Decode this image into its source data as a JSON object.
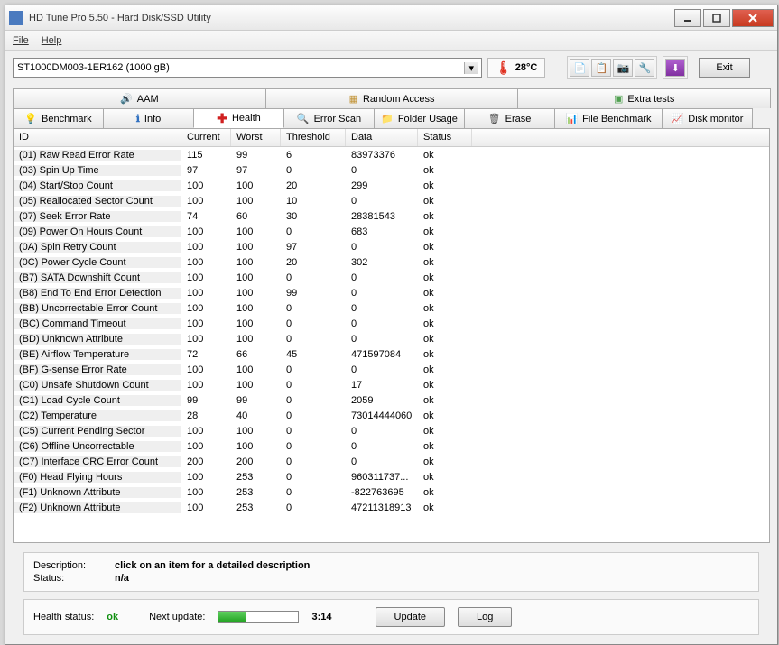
{
  "window": {
    "title": "HD Tune Pro 5.50 - Hard Disk/SSD Utility"
  },
  "menu": {
    "file": "File",
    "help": "Help"
  },
  "toolbar": {
    "drive": "ST1000DM003-1ER162 (1000 gB)",
    "temp": "28°C",
    "exit": "Exit"
  },
  "tabs_top": {
    "aam": "AAM",
    "random": "Random Access",
    "extra": "Extra tests"
  },
  "tabs_bottom": {
    "benchmark": "Benchmark",
    "info": "Info",
    "health": "Health",
    "errorscan": "Error Scan",
    "folder": "Folder Usage",
    "erase": "Erase",
    "filebench": "File Benchmark",
    "diskmon": "Disk monitor"
  },
  "columns": {
    "id": "ID",
    "current": "Current",
    "worst": "Worst",
    "threshold": "Threshold",
    "data": "Data",
    "status": "Status"
  },
  "rows": [
    {
      "id": "(01) Raw Read Error Rate",
      "cur": "115",
      "worst": "99",
      "thr": "6",
      "data": "83973376",
      "st": "ok"
    },
    {
      "id": "(03) Spin Up Time",
      "cur": "97",
      "worst": "97",
      "thr": "0",
      "data": "0",
      "st": "ok"
    },
    {
      "id": "(04) Start/Stop Count",
      "cur": "100",
      "worst": "100",
      "thr": "20",
      "data": "299",
      "st": "ok"
    },
    {
      "id": "(05) Reallocated Sector Count",
      "cur": "100",
      "worst": "100",
      "thr": "10",
      "data": "0",
      "st": "ok"
    },
    {
      "id": "(07) Seek Error Rate",
      "cur": "74",
      "worst": "60",
      "thr": "30",
      "data": "28381543",
      "st": "ok"
    },
    {
      "id": "(09) Power On Hours Count",
      "cur": "100",
      "worst": "100",
      "thr": "0",
      "data": "683",
      "st": "ok"
    },
    {
      "id": "(0A) Spin Retry Count",
      "cur": "100",
      "worst": "100",
      "thr": "97",
      "data": "0",
      "st": "ok"
    },
    {
      "id": "(0C) Power Cycle Count",
      "cur": "100",
      "worst": "100",
      "thr": "20",
      "data": "302",
      "st": "ok"
    },
    {
      "id": "(B7) SATA Downshift Count",
      "cur": "100",
      "worst": "100",
      "thr": "0",
      "data": "0",
      "st": "ok"
    },
    {
      "id": "(B8) End To End Error Detection",
      "cur": "100",
      "worst": "100",
      "thr": "99",
      "data": "0",
      "st": "ok"
    },
    {
      "id": "(BB) Uncorrectable Error Count",
      "cur": "100",
      "worst": "100",
      "thr": "0",
      "data": "0",
      "st": "ok"
    },
    {
      "id": "(BC) Command Timeout",
      "cur": "100",
      "worst": "100",
      "thr": "0",
      "data": "0",
      "st": "ok"
    },
    {
      "id": "(BD) Unknown Attribute",
      "cur": "100",
      "worst": "100",
      "thr": "0",
      "data": "0",
      "st": "ok"
    },
    {
      "id": "(BE) Airflow Temperature",
      "cur": "72",
      "worst": "66",
      "thr": "45",
      "data": "471597084",
      "st": "ok"
    },
    {
      "id": "(BF) G-sense Error Rate",
      "cur": "100",
      "worst": "100",
      "thr": "0",
      "data": "0",
      "st": "ok"
    },
    {
      "id": "(C0) Unsafe Shutdown Count",
      "cur": "100",
      "worst": "100",
      "thr": "0",
      "data": "17",
      "st": "ok"
    },
    {
      "id": "(C1) Load Cycle Count",
      "cur": "99",
      "worst": "99",
      "thr": "0",
      "data": "2059",
      "st": "ok"
    },
    {
      "id": "(C2) Temperature",
      "cur": "28",
      "worst": "40",
      "thr": "0",
      "data": "73014444060",
      "st": "ok"
    },
    {
      "id": "(C5) Current Pending Sector",
      "cur": "100",
      "worst": "100",
      "thr": "0",
      "data": "0",
      "st": "ok"
    },
    {
      "id": "(C6) Offline Uncorrectable",
      "cur": "100",
      "worst": "100",
      "thr": "0",
      "data": "0",
      "st": "ok"
    },
    {
      "id": "(C7) Interface CRC Error Count",
      "cur": "200",
      "worst": "200",
      "thr": "0",
      "data": "0",
      "st": "ok"
    },
    {
      "id": "(F0) Head Flying Hours",
      "cur": "100",
      "worst": "253",
      "thr": "0",
      "data": "960311737...",
      "st": "ok"
    },
    {
      "id": "(F1) Unknown Attribute",
      "cur": "100",
      "worst": "253",
      "thr": "0",
      "data": "-822763695",
      "st": "ok"
    },
    {
      "id": "(F2) Unknown Attribute",
      "cur": "100",
      "worst": "253",
      "thr": "0",
      "data": "47211318913",
      "st": "ok"
    }
  ],
  "description": {
    "label": "Description:",
    "text": "click on an item for a detailed description",
    "status_label": "Status:",
    "status_value": "n/a"
  },
  "health": {
    "label": "Health status:",
    "value": "ok",
    "next_update_label": "Next update:",
    "time": "3:14",
    "update_btn": "Update",
    "log_btn": "Log"
  }
}
